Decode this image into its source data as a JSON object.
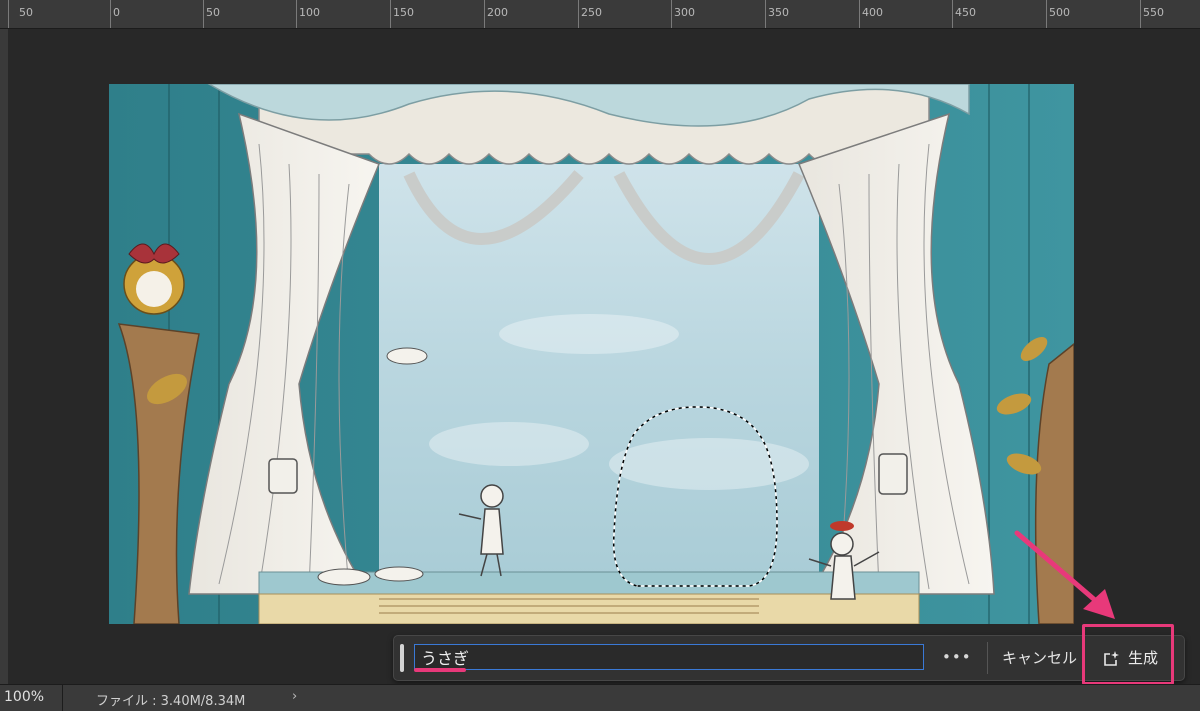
{
  "ruler": {
    "labels": [
      "50",
      "0",
      "50",
      "100",
      "150",
      "200",
      "250",
      "300",
      "350",
      "400",
      "450",
      "500",
      "550"
    ]
  },
  "taskbar": {
    "prompt_value": "うさぎ",
    "more_label": "•••",
    "cancel_label": "キャンセル",
    "generate_label": "生成",
    "generate_icon": "generate-sparkle-icon"
  },
  "statusbar": {
    "zoom": "100%",
    "file_info": "ファイル : 3.40M/8.34M",
    "chevron": "›"
  },
  "colors": {
    "annotation": "#e8397a",
    "input_focus": "#3a79d6",
    "panel": "#323232"
  }
}
